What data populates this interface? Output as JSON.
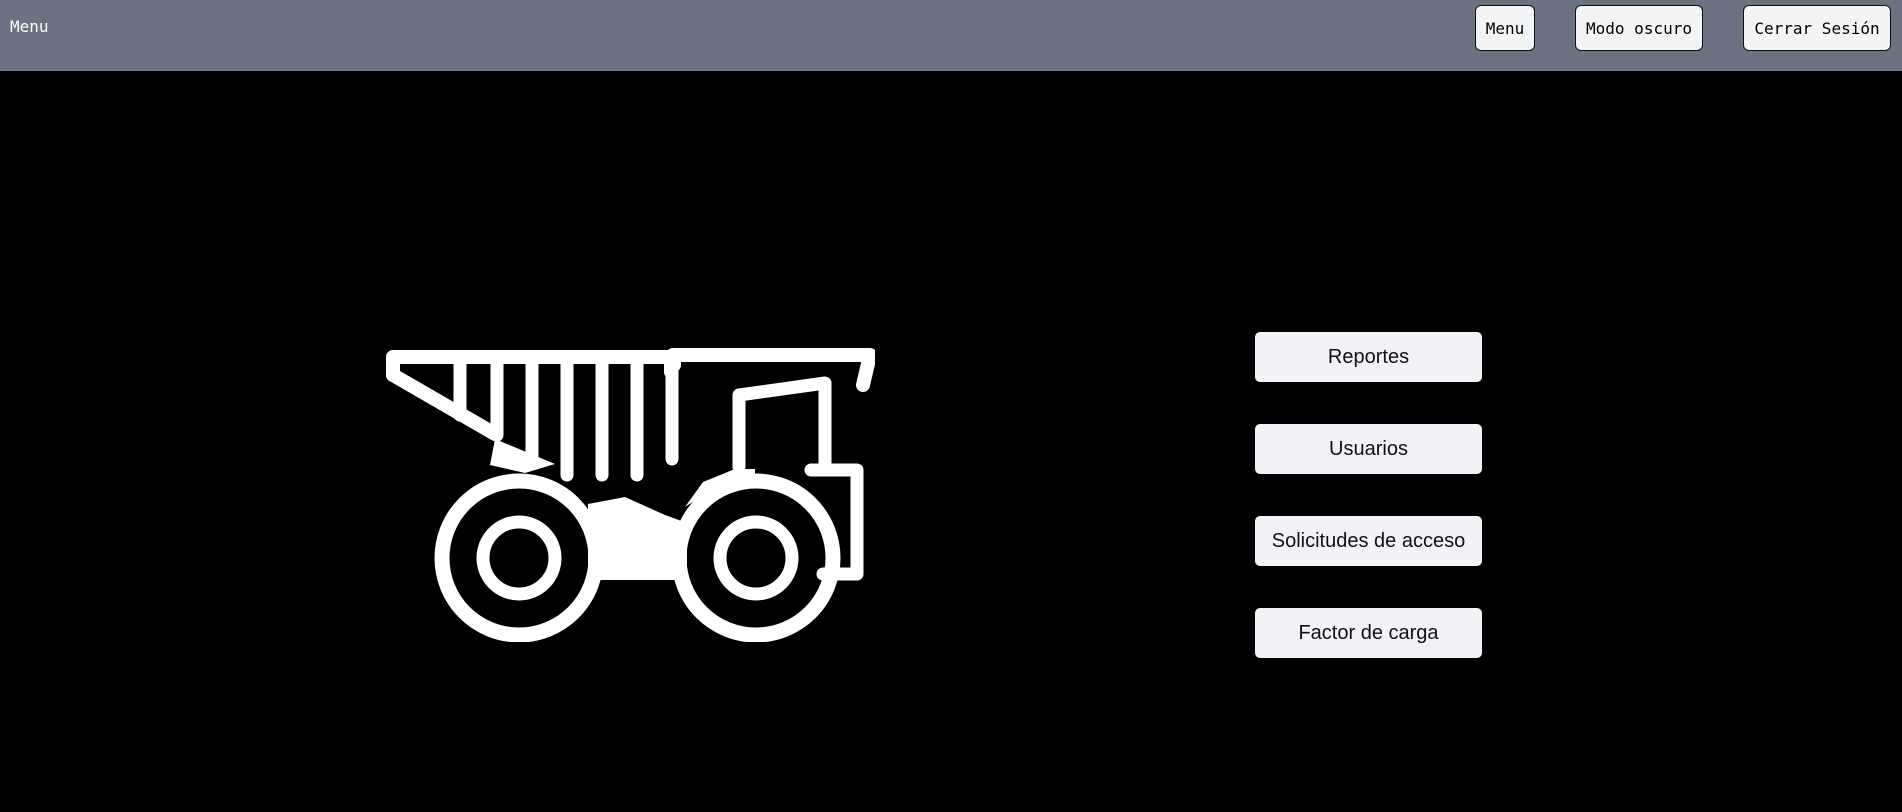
{
  "header": {
    "brand": "Menu",
    "buttons": {
      "menu": "Menu",
      "dark_mode": "Modo oscuro",
      "logout": "Cerrar Sesión"
    },
    "background_color": "#6b7280"
  },
  "main": {
    "illustration_icon": "mining-dump-truck-icon",
    "menu_items": [
      "Reportes",
      "Usuarios",
      "Solicitudes de acceso",
      "Factor de carga"
    ],
    "background_color": "#000000"
  }
}
